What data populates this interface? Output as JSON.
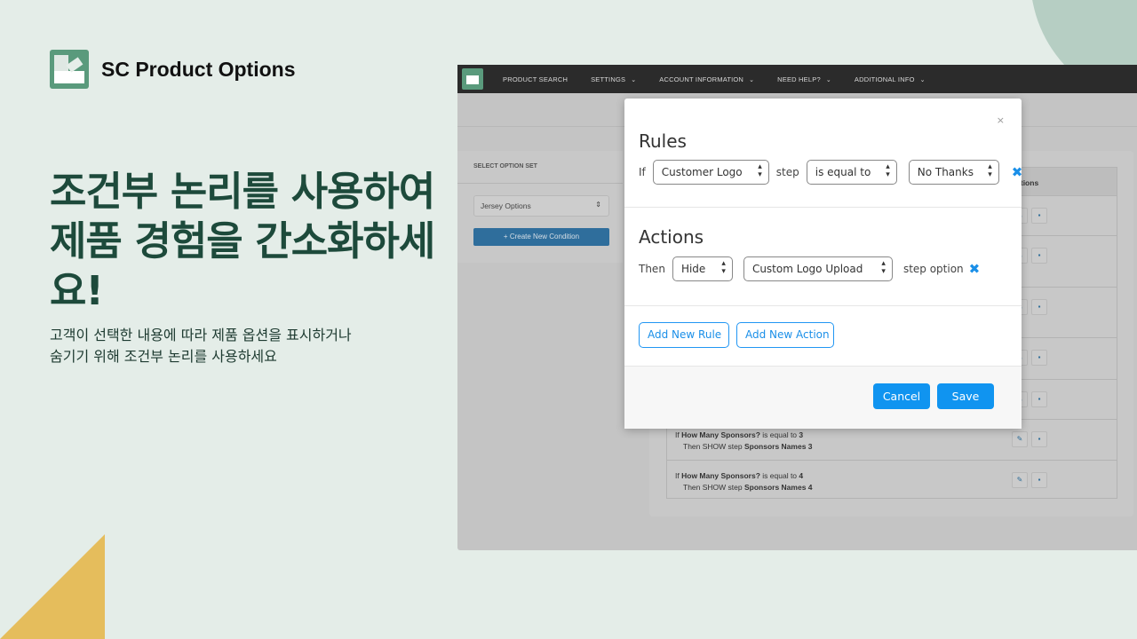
{
  "brand": {
    "name": "SC Product Options"
  },
  "headline": "조건부 논리를 사용하여 제품 경험을 간소화하세요!",
  "subtext": "고객이 선택한 내용에 따라 제품 옵션을 표시하거나 숨기기 위해 조건부 논리를 사용하세요",
  "colors": {
    "background": "#e4ede8",
    "heading": "#1d4a3b",
    "accent": "#1094f0",
    "circle": "#b6cec3",
    "triangle": "#e5bd5c"
  },
  "app": {
    "nav": [
      "PRODUCT SEARCH",
      "SETTINGS",
      "ACCOUNT INFORMATION",
      "NEED HELP?",
      "ADDITIONAL INFO"
    ],
    "select_option_set_label": "SELECT OPTION SET",
    "option_set_value": "Jersey Options",
    "create_button": "+ Create New Condition",
    "table_header": "Actions",
    "rows": [
      {
        "if": "",
        "then": ""
      },
      {
        "if": "",
        "then": ""
      },
      {
        "if": "",
        "then": ""
      },
      {
        "if": "",
        "then": ""
      },
      {
        "if": "",
        "then": ""
      },
      {
        "if_prefix": "If",
        "field": "How Many Sponsors?",
        "op": "is equal to",
        "value": "3",
        "then_prefix": "Then SHOW step",
        "target": "Sponsors Names 3"
      },
      {
        "if_prefix": "If",
        "field": "How Many Sponsors?",
        "op": "is equal to",
        "value": "4",
        "then_prefix": "Then SHOW step",
        "target": "Sponsors Names 4"
      }
    ]
  },
  "modal": {
    "close": "×",
    "rules_title": "Rules",
    "rule": {
      "if": "If",
      "field": "Customer Logo",
      "step": "step",
      "operator": "is equal to",
      "value": "No Thanks"
    },
    "actions_title": "Actions",
    "action": {
      "then": "Then",
      "verb": "Hide",
      "target": "Custom Logo Upload",
      "suffix": "step option"
    },
    "add_rule": "Add New Rule",
    "add_action": "Add New Action",
    "cancel": "Cancel",
    "save": "Save"
  }
}
